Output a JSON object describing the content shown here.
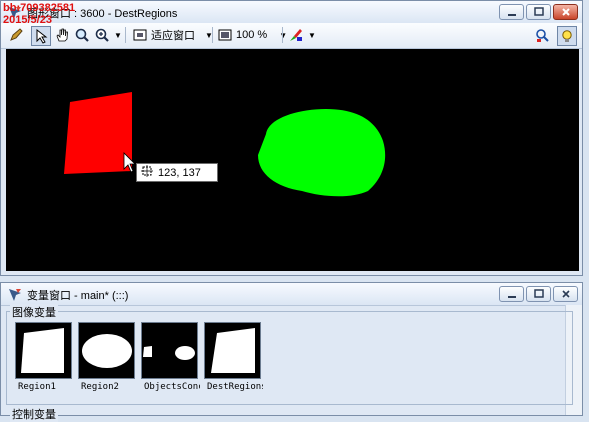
{
  "graphics_window": {
    "title": "图形窗口 : 3600 - DestRegions",
    "toolbar": {
      "fit_label": "适应窗口",
      "zoom_label": "100 %"
    },
    "tooltip_coords": "123,  137",
    "regions": [
      {
        "name": "red-region",
        "color": "#ff0000"
      },
      {
        "name": "green-region",
        "color": "#00ff00"
      }
    ]
  },
  "overlay": {
    "qq": "bb:709382581",
    "date": "2015/5/23"
  },
  "variable_window": {
    "title": "变量窗口 - main* (:::)",
    "image_vars_label": "图像变量",
    "control_vars_label": "控制变量",
    "thumbnails": [
      {
        "label": "Region1"
      },
      {
        "label": "Region2"
      },
      {
        "label": "ObjectsConc"
      },
      {
        "label": "DestRegions"
      }
    ]
  },
  "colors": {
    "canvas_bg": "#000000",
    "window_bg": "#dfe8f4",
    "accent_red": "#ff0000",
    "accent_green": "#00ff00"
  }
}
